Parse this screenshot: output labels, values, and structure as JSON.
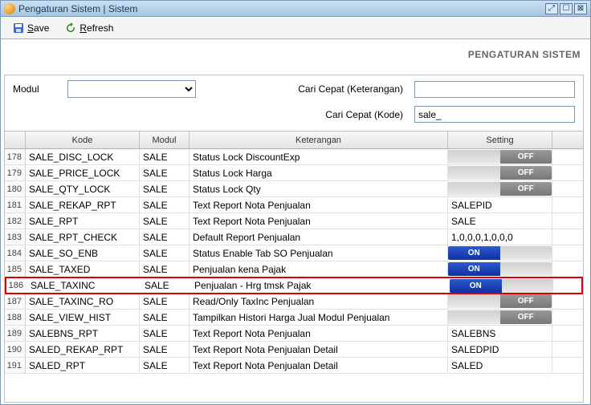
{
  "window": {
    "title": "Pengaturan Sistem | Sistem"
  },
  "toolbar": {
    "save": "Save",
    "refresh": "Refresh"
  },
  "panel": {
    "title": "PENGATURAN SISTEM",
    "modul_label": "Modul",
    "search_desc_label": "Cari Cepat (Keterangan)",
    "search_code_label": "Cari Cepat (Kode)",
    "search_desc_value": "",
    "search_code_value": "sale_"
  },
  "grid": {
    "headers": {
      "num": "",
      "kode": "Kode",
      "modul": "Modul",
      "keterangan": "Keterangan",
      "setting": "Setting"
    },
    "rows": [
      {
        "num": "178",
        "kode": "SALE_DISC_LOCK",
        "modul": "SALE",
        "keterangan": "Status Lock DiscountExp",
        "setting_type": "toggle",
        "setting_val": "OFF"
      },
      {
        "num": "179",
        "kode": "SALE_PRICE_LOCK",
        "modul": "SALE",
        "keterangan": "Status Lock Harga",
        "setting_type": "toggle",
        "setting_val": "OFF"
      },
      {
        "num": "180",
        "kode": "SALE_QTY_LOCK",
        "modul": "SALE",
        "keterangan": "Status Lock Qty",
        "setting_type": "toggle",
        "setting_val": "OFF"
      },
      {
        "num": "181",
        "kode": "SALE_REKAP_RPT",
        "modul": "SALE",
        "keterangan": "Text Report Nota Penjualan",
        "setting_type": "text",
        "setting_val": "SALEPID"
      },
      {
        "num": "182",
        "kode": "SALE_RPT",
        "modul": "SALE",
        "keterangan": "Text Report Nota Penjualan",
        "setting_type": "text",
        "setting_val": "SALE"
      },
      {
        "num": "183",
        "kode": "SALE_RPT_CHECK",
        "modul": "SALE",
        "keterangan": "Default Report Penjualan",
        "setting_type": "text",
        "setting_val": "1,0,0,0,1,0,0,0"
      },
      {
        "num": "184",
        "kode": "SALE_SO_ENB",
        "modul": "SALE",
        "keterangan": "Status Enable Tab SO Penjualan",
        "setting_type": "toggle",
        "setting_val": "ON"
      },
      {
        "num": "185",
        "kode": "SALE_TAXED",
        "modul": "SALE",
        "keterangan": "Penjualan kena Pajak",
        "setting_type": "toggle",
        "setting_val": "ON"
      },
      {
        "num": "186",
        "kode": "SALE_TAXINC",
        "modul": "SALE",
        "keterangan": "Penjualan - Hrg tmsk Pajak",
        "setting_type": "toggle",
        "setting_val": "ON",
        "highlight": true
      },
      {
        "num": "187",
        "kode": "SALE_TAXINC_RO",
        "modul": "SALE",
        "keterangan": "Read/Only TaxInc Penjualan",
        "setting_type": "toggle",
        "setting_val": "OFF"
      },
      {
        "num": "188",
        "kode": "SALE_VIEW_HIST",
        "modul": "SALE",
        "keterangan": "Tampilkan Histori Harga Jual Modul Penjualan",
        "setting_type": "toggle",
        "setting_val": "OFF"
      },
      {
        "num": "189",
        "kode": "SALEBNS_RPT",
        "modul": "SALE",
        "keterangan": "Text Report Nota Penjualan",
        "setting_type": "text",
        "setting_val": "SALEBNS"
      },
      {
        "num": "190",
        "kode": "SALED_REKAP_RPT",
        "modul": "SALE",
        "keterangan": "Text Report Nota Penjualan Detail",
        "setting_type": "text",
        "setting_val": "SALEDPID"
      },
      {
        "num": "191",
        "kode": "SALED_RPT",
        "modul": "SALE",
        "keterangan": "Text Report Nota Penjualan Detail",
        "setting_type": "text",
        "setting_val": "SALED"
      }
    ]
  }
}
